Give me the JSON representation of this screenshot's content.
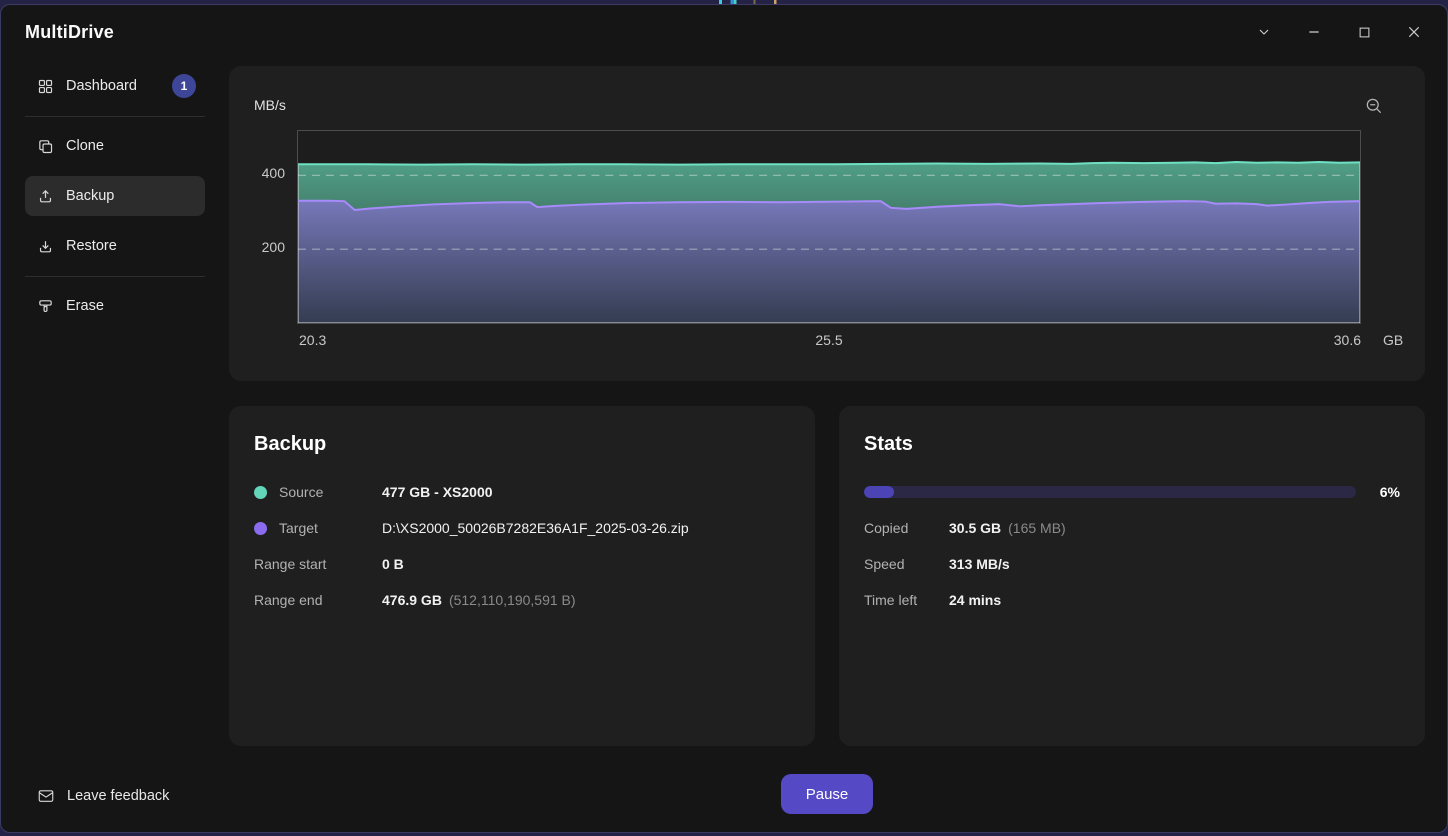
{
  "window": {
    "title": "MultiDrive",
    "controls": {
      "menu": "chevron-down",
      "minimize": "minimize",
      "maximize": "maximize",
      "close": "close"
    }
  },
  "sidebar": {
    "active_item": "Backup",
    "items": [
      {
        "label": "Dashboard",
        "icon": "grid-icon",
        "badge": "1"
      },
      {
        "label": "Clone",
        "icon": "copy-icon"
      },
      {
        "label": "Backup",
        "icon": "upload-icon"
      },
      {
        "label": "Restore",
        "icon": "download-icon"
      },
      {
        "label": "Erase",
        "icon": "scraper-icon"
      }
    ]
  },
  "chart": {
    "y_unit": "MB/s",
    "x_unit": "GB",
    "y_ticks": [
      "400",
      "200"
    ],
    "x_ticks": [
      "20.3",
      "25.5",
      "30.6"
    ],
    "zoom_icon": "zoom-out"
  },
  "chart_data": {
    "type": "area",
    "title": "",
    "xlabel": "GB",
    "ylabel": "MB/s",
    "xlim": [
      20.3,
      30.6
    ],
    "ylim": [
      0,
      520
    ],
    "x_ticks": [
      20.3,
      25.5,
      30.6
    ],
    "y_ticks": [
      400,
      200
    ],
    "gridlines_y": [
      400,
      200
    ],
    "grid_style": "dashed",
    "legend": "none",
    "series": [
      {
        "name": "Source",
        "color": "#6fe0c2",
        "fill_top": "rgba(92,188,158,0.82)",
        "fill_bottom": "rgba(62,116,100,0.50)",
        "points": [
          [
            20.3,
            430
          ],
          [
            21.0,
            430
          ],
          [
            21.5,
            429
          ],
          [
            22.0,
            430
          ],
          [
            22.5,
            429
          ],
          [
            23.0,
            430
          ],
          [
            23.5,
            430
          ],
          [
            24.0,
            429
          ],
          [
            24.5,
            430
          ],
          [
            25.0,
            430
          ],
          [
            25.5,
            430
          ],
          [
            26.0,
            431
          ],
          [
            26.5,
            432
          ],
          [
            27.0,
            431
          ],
          [
            27.5,
            432
          ],
          [
            27.8,
            431
          ],
          [
            28.0,
            433
          ],
          [
            28.2,
            434
          ],
          [
            28.5,
            433
          ],
          [
            28.8,
            434
          ],
          [
            29.0,
            435
          ],
          [
            29.2,
            433
          ],
          [
            29.4,
            436
          ],
          [
            29.6,
            434
          ],
          [
            29.8,
            435
          ],
          [
            30.0,
            434
          ],
          [
            30.2,
            436
          ],
          [
            30.4,
            434
          ],
          [
            30.6,
            435
          ]
        ]
      },
      {
        "name": "Target",
        "color": "#a78bfa",
        "fill_top": "rgba(122,119,190,0.95)",
        "fill_bottom": "rgba(54,58,86,0.80)",
        "points": [
          [
            20.3,
            331
          ],
          [
            20.6,
            331
          ],
          [
            20.75,
            330
          ],
          [
            20.85,
            306
          ],
          [
            21.0,
            310
          ],
          [
            21.3,
            316
          ],
          [
            21.6,
            321
          ],
          [
            22.0,
            325
          ],
          [
            22.3,
            327
          ],
          [
            22.55,
            327
          ],
          [
            22.62,
            314
          ],
          [
            22.8,
            317
          ],
          [
            23.1,
            321
          ],
          [
            23.5,
            325
          ],
          [
            24.0,
            327
          ],
          [
            24.5,
            328
          ],
          [
            25.0,
            327
          ],
          [
            25.3,
            328
          ],
          [
            25.6,
            329
          ],
          [
            25.95,
            330
          ],
          [
            26.05,
            312
          ],
          [
            26.2,
            309
          ],
          [
            26.5,
            315
          ],
          [
            26.8,
            319
          ],
          [
            27.1,
            322
          ],
          [
            27.3,
            316
          ],
          [
            27.5,
            319
          ],
          [
            27.8,
            322
          ],
          [
            28.1,
            325
          ],
          [
            28.5,
            328
          ],
          [
            28.9,
            330
          ],
          [
            29.1,
            329
          ],
          [
            29.2,
            323
          ],
          [
            29.4,
            324
          ],
          [
            29.6,
            322
          ],
          [
            29.7,
            318
          ],
          [
            29.9,
            321
          ],
          [
            30.1,
            325
          ],
          [
            30.3,
            328
          ],
          [
            30.6,
            330
          ]
        ]
      }
    ]
  },
  "backup_card": {
    "title": "Backup",
    "rows": [
      {
        "label": "Source",
        "dot_color": "#63d6ba",
        "value": "477 GB - XS2000"
      },
      {
        "label": "Target",
        "dot_color": "#8b6cf0",
        "value": "D:\\XS2000_50026B7282E36A1F_2025-03-26.zip"
      },
      {
        "label": "Range start",
        "value": "0 B"
      },
      {
        "label": "Range end",
        "value": "476.9 GB",
        "extra": "(512,110,190,591 B)"
      }
    ]
  },
  "stats_card": {
    "title": "Stats",
    "progress": {
      "value": 6,
      "percent_label": "6%"
    },
    "rows": [
      {
        "label": "Copied",
        "value": "30.5 GB",
        "extra": "(165 MB)"
      },
      {
        "label": "Speed",
        "value": "313 MB/s"
      },
      {
        "label": "Time left",
        "value": "24 mins"
      }
    ]
  },
  "footer": {
    "feedback_label": "Leave feedback",
    "pause_label": "Pause"
  },
  "colors": {
    "accent": "#5549c6",
    "badge": "#3e4697",
    "progress_fill": "#4c43b5",
    "progress_track": "#2b2845",
    "source_dot": "#63d6ba",
    "target_dot": "#8b6cf0"
  }
}
